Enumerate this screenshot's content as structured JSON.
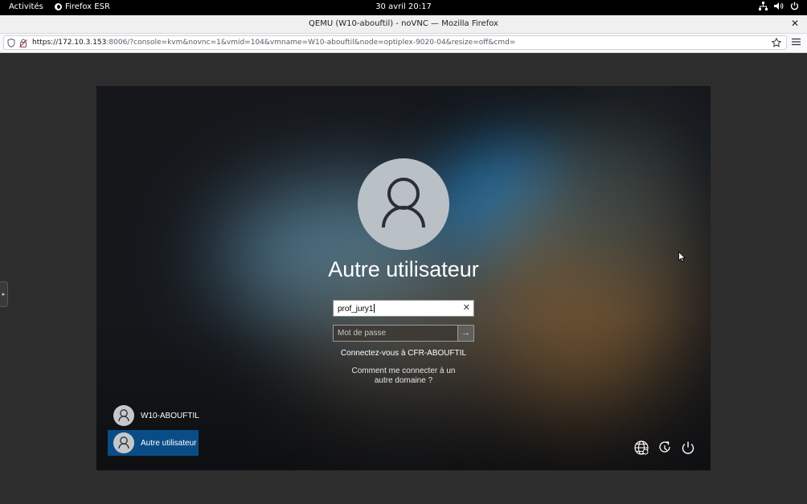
{
  "topbar": {
    "activities": "Activités",
    "app_name": "Firefox ESR",
    "clock": "30 avril  20:17"
  },
  "browser": {
    "window_title": "QEMU (W10-abouftil) - noVNC — Mozilla Firefox",
    "url_host": "https://172.10.3.153",
    "url_rest": ":8006/?console=kvm&novnc=1&vmid=104&vmname=W10-abouftil&node=optiplex-9020-04&resize=off&cmd="
  },
  "login": {
    "user_title": "Autre utilisateur",
    "username_value": "prof_jury1",
    "password_placeholder": "Mot de passe",
    "domain_link": "Connectez-vous à CFR-ABOUFTIL",
    "other_domain_link": "Comment me connecter à un autre domaine ?",
    "accounts": [
      {
        "label": "W10-ABOUFTIL",
        "selected": false
      },
      {
        "label": "Autre utilisateur",
        "selected": true
      }
    ],
    "selected_color": "#0a4d86"
  },
  "icons": {
    "network": "network-icon",
    "volume": "volume-icon",
    "power": "power-icon",
    "language": "globe-icon",
    "ease_of_access": "accessibility-icon",
    "shutdown": "power-icon"
  }
}
